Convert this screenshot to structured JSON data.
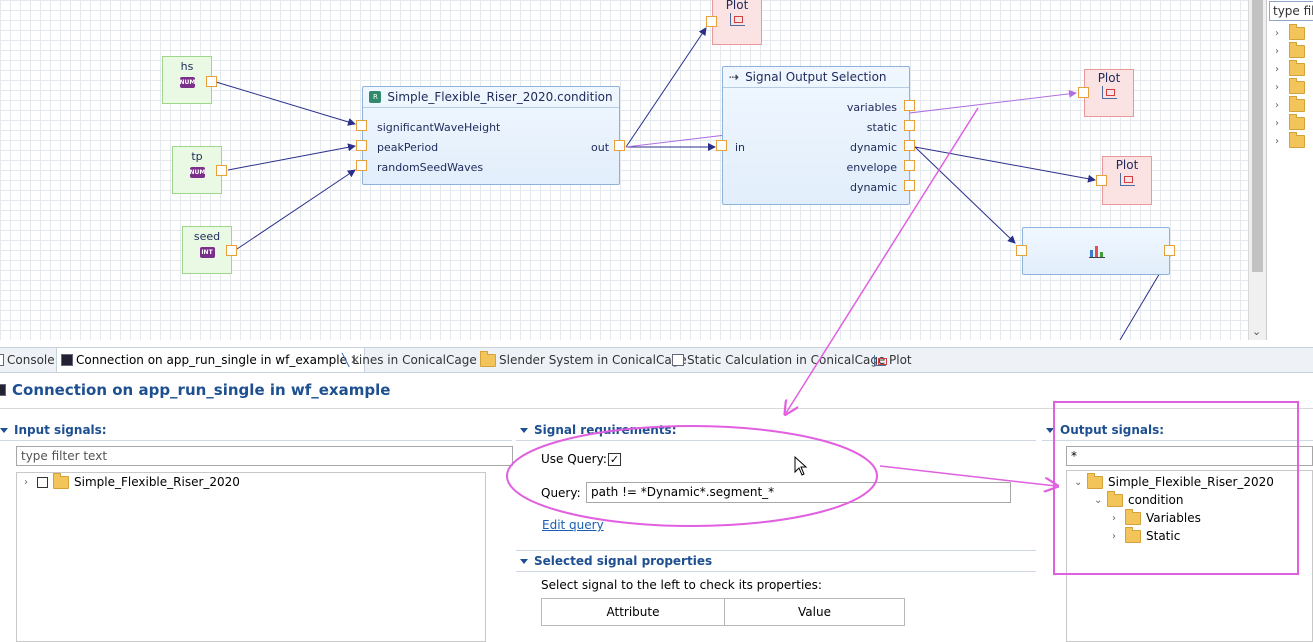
{
  "canvas": {
    "nodes": {
      "hs": {
        "title": "hs",
        "badge": "NUM"
      },
      "tp": {
        "title": "tp",
        "badge": "NUM"
      },
      "seed": {
        "title": "seed",
        "badge": "INT"
      },
      "condition": {
        "title": "Simple_Flexible_Riser_2020.condition",
        "inputs": [
          "significantWaveHeight",
          "peakPeriod",
          "randomSeedWaves"
        ],
        "output": "out"
      },
      "signal_output": {
        "title": "Signal Output Selection",
        "input": "in",
        "outputs": [
          "variables",
          "static",
          "dynamic",
          "envelope",
          "dynamic"
        ]
      },
      "plots": [
        "Plot",
        "Plot",
        "Plot"
      ]
    }
  },
  "right_panel": {
    "filter_text": "type filt",
    "folder_count": 7
  },
  "tabs": [
    {
      "label": "Console",
      "active": false
    },
    {
      "label": "Connection on app_run_single in wf_example",
      "active": true
    },
    {
      "label": "Lines in ConicalCage",
      "active": false
    },
    {
      "label": "Slender System in ConicalCage",
      "active": false
    },
    {
      "label": "Static Calculation in ConicalCage",
      "active": false
    },
    {
      "label": "Plot",
      "active": false
    }
  ],
  "view": {
    "title": "Connection on app_run_single in wf_example",
    "input_signals": {
      "heading": "Input signals:",
      "filter_placeholder": "type filter text",
      "tree": [
        "Simple_Flexible_Riser_2020"
      ]
    },
    "signal_requirements": {
      "heading": "Signal requirements:",
      "use_query_label": "Use Query:",
      "use_query_checked": true,
      "query_label": "Query:",
      "query_value": "path != *Dynamic*.segment_*",
      "edit_query_link": "Edit query"
    },
    "selected_signal_properties": {
      "heading": "Selected signal properties",
      "hint": "Select signal to the left to check its properties:",
      "columns": [
        "Attribute",
        "Value"
      ]
    },
    "output_signals": {
      "heading": "Output signals:",
      "filter_value": "*",
      "tree": {
        "root": "Simple_Flexible_Riser_2020",
        "child": "condition",
        "grandchildren": [
          "Variables",
          "Static"
        ]
      }
    }
  },
  "colors": {
    "accent": "#1d4f91",
    "annotation": "#e060e0",
    "wire": "#2a2f8a"
  }
}
